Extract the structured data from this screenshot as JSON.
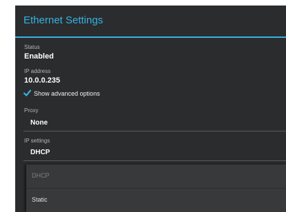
{
  "dialog": {
    "title": "Ethernet Settings"
  },
  "status": {
    "label": "Status",
    "value": "Enabled"
  },
  "ip_address": {
    "label": "IP address",
    "value": "10.0.0.235"
  },
  "advanced": {
    "label": "Show advanced options",
    "checked": true,
    "icon": "checkmark-icon"
  },
  "proxy": {
    "label": "Proxy",
    "value": "None"
  },
  "ip_settings": {
    "label": "IP settings",
    "value": "DHCP",
    "options": [
      "DHCP",
      "Static"
    ]
  },
  "colors": {
    "accent": "#33b5e5",
    "background": "#2b2c2e"
  }
}
